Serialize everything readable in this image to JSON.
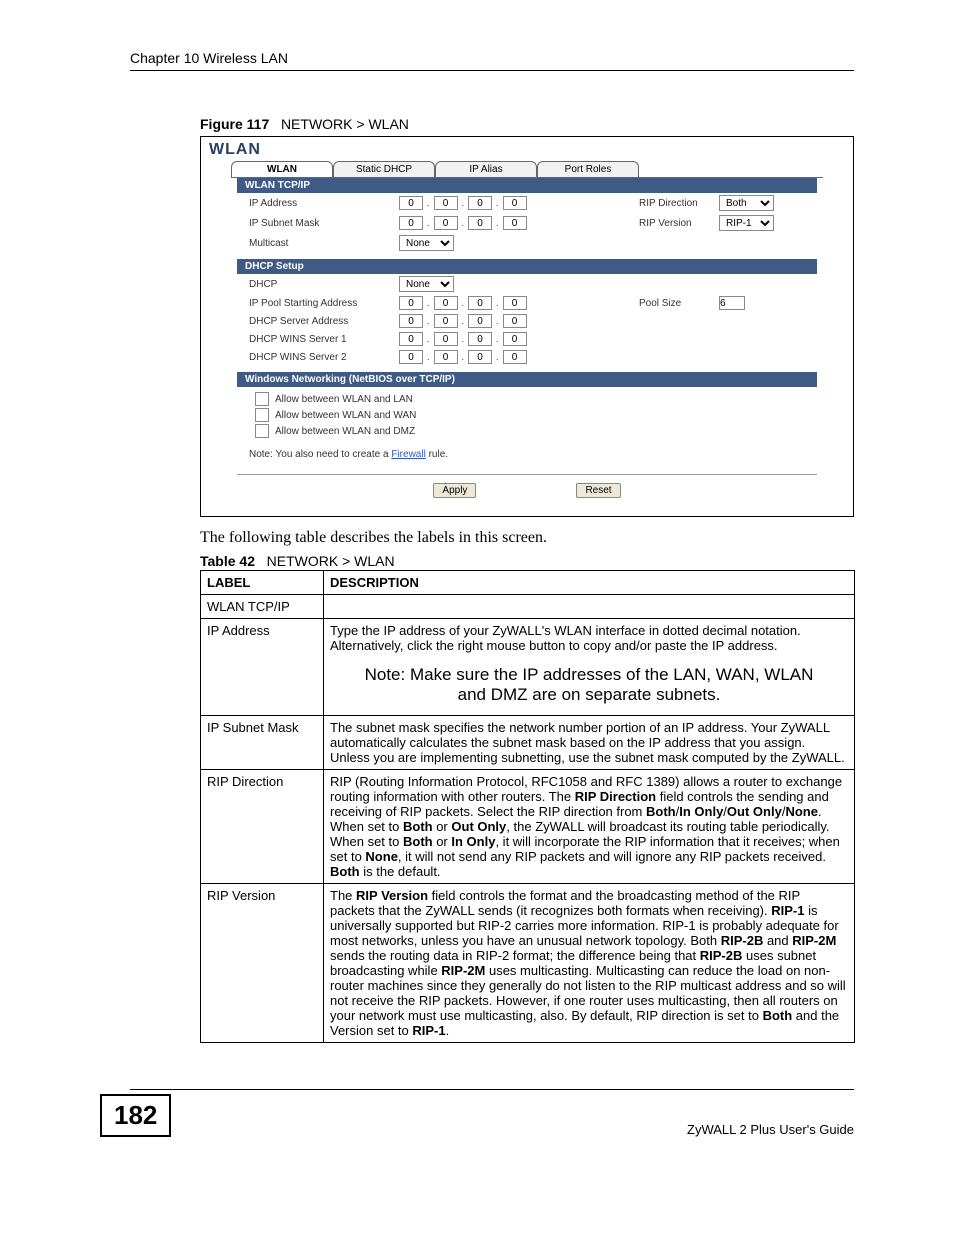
{
  "header": "Chapter 10 Wireless LAN",
  "figure_caption_bold": "Figure 117",
  "figure_caption_rest": "NETWORK > WLAN",
  "ui": {
    "title": "WLAN",
    "tabs": [
      "WLAN",
      "Static DHCP",
      "IP Alias",
      "Port Roles"
    ],
    "sections": {
      "tcpip": "WLAN TCP/IP",
      "dhcp": "DHCP Setup",
      "winnet": "Windows Networking (NetBIOS over TCP/IP)"
    },
    "labels": {
      "ip_address": "IP Address",
      "ip_subnet": "IP Subnet Mask",
      "multicast": "Multicast",
      "rip_direction": "RIP Direction",
      "rip_version": "RIP Version",
      "dhcp": "DHCP",
      "ip_pool_start": "IP Pool Starting Address",
      "dhcp_server_addr": "DHCP Server Address",
      "wins1": "DHCP WINS Server 1",
      "wins2": "DHCP WINS Server 2",
      "pool_size": "Pool Size"
    },
    "values": {
      "ip": [
        "0",
        "0",
        "0",
        "0"
      ],
      "subnet": [
        "0",
        "0",
        "0",
        "0"
      ],
      "pool_start": [
        "0",
        "0",
        "0",
        "0"
      ],
      "dhcp_server": [
        "0",
        "0",
        "0",
        "0"
      ],
      "wins1": [
        "0",
        "0",
        "0",
        "0"
      ],
      "wins2": [
        "0",
        "0",
        "0",
        "0"
      ],
      "multicast": "None",
      "dhcp": "None",
      "rip_direction": "Both",
      "rip_version": "RIP-1",
      "pool_size": "6"
    },
    "checks": {
      "wlan_lan": "Allow between WLAN and LAN",
      "wlan_wan": "Allow between WLAN and WAN",
      "wlan_dmz": "Allow between WLAN and DMZ"
    },
    "note_prefix": "Note: You also need to create a ",
    "note_link": "Firewall",
    "note_suffix": " rule.",
    "btn_apply": "Apply",
    "btn_reset": "Reset"
  },
  "body_text": "The following table describes the labels in this screen.",
  "table_caption_bold": "Table 42",
  "table_caption_rest": "NETWORK > WLAN",
  "table": {
    "head_label": "LABEL",
    "head_desc": "DESCRIPTION",
    "rows": [
      {
        "label": "WLAN TCP/IP",
        "desc": ""
      },
      {
        "label": "IP Address",
        "desc": "Type the IP address of your ZyWALL's WLAN interface in dotted decimal notation. Alternatively, click the right mouse button to copy and/or paste the IP address.",
        "note": "Note: Make sure the IP addresses of the LAN, WAN, WLAN and DMZ are on separate subnets."
      },
      {
        "label": "IP Subnet Mask",
        "desc": "The subnet mask specifies the network number portion of an IP address. Your ZyWALL automatically calculates the subnet mask based on the IP address that you assign. Unless you are implementing subnetting, use the subnet mask computed by the ZyWALL."
      },
      {
        "label": "RIP Direction",
        "desc_html": "RIP (Routing Information Protocol, RFC1058 and RFC 1389) allows a router to exchange routing information with other routers. The <b>RIP Direction</b> field controls the sending and receiving of RIP packets. Select the RIP direction from <b>Both</b>/<b>In Only</b>/<b>Out Only</b>/<b>None</b>. When set to <b>Both</b> or <b>Out Only</b>, the ZyWALL will broadcast its routing table periodically. When set to <b>Both</b> or <b>In Only</b>, it will incorporate the RIP information that it receives; when set to <b>None</b>, it will not send any RIP packets and will ignore any RIP packets received. <b>Both</b> is the default."
      },
      {
        "label": "RIP Version",
        "desc_html": "The <b>RIP Version</b> field controls the format and the broadcasting method of the RIP packets that the ZyWALL sends (it recognizes both formats when receiving). <b>RIP-1</b> is universally supported but RIP-2 carries more information. RIP-1 is probably adequate for most networks, unless you have an unusual network topology. Both <b>RIP-2B</b> and <b>RIP-2M</b> sends the routing data in RIP-2 format; the difference being that <b>RIP-2B</b> uses subnet broadcasting while <b>RIP-2M</b> uses multicasting. Multicasting can reduce the load on non-router machines since they generally do not listen to the RIP multicast address and so will not receive the RIP packets. However, if one router uses multicasting, then all routers on your network must use multicasting, also. By default, RIP direction is set to <b>Both</b> and the Version set to <b>RIP-1</b>."
      }
    ]
  },
  "footer": {
    "page": "182",
    "guide": "ZyWALL 2 Plus User's Guide"
  }
}
